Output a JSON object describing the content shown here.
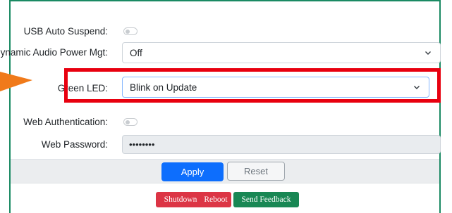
{
  "settings": {
    "usb_auto_suspend": {
      "label": "USB Auto Suspend:",
      "enabled": false
    },
    "dynamic_audio_power": {
      "label": "Dynamic Audio Power Mgt:",
      "value": "Off"
    },
    "green_led": {
      "label": "Green LED:",
      "value": "Blink on Update"
    },
    "web_authentication": {
      "label": "Web Authentication:",
      "enabled": false
    },
    "web_password": {
      "label": "Web Password:",
      "value": "••••••••"
    }
  },
  "actions": {
    "apply_label": "Apply",
    "reset_label": "Reset"
  },
  "system": {
    "shutdown_label": "Shutdown",
    "reboot_label": "Reboot",
    "feedback_label": "Send Feedback"
  },
  "colors": {
    "panel_border": "#1a8a63",
    "highlight_frame": "#e8000f",
    "arrow": "#f07a1a",
    "primary": "#0d6efd",
    "danger": "#dc3545",
    "success": "#198754"
  }
}
